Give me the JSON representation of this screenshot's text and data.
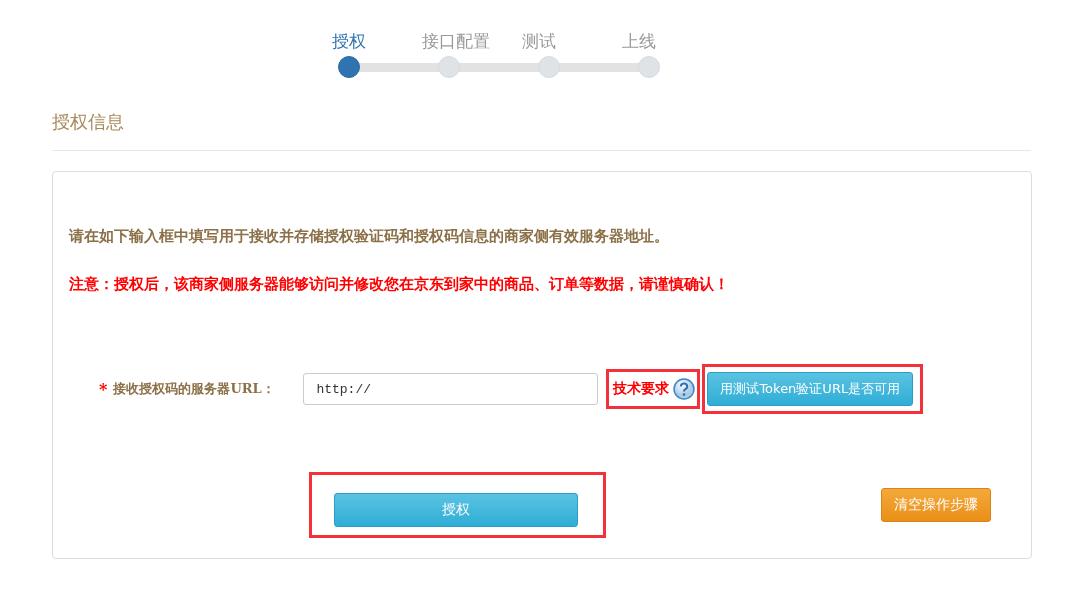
{
  "steps": [
    {
      "label": "授权",
      "selected": true
    },
    {
      "label": "接口配置",
      "selected": false
    },
    {
      "label": "测试",
      "selected": false
    },
    {
      "label": "上线",
      "selected": false
    }
  ],
  "section_title": "授权信息",
  "intro": "请在如下输入框中填写用于接收并存储授权验证码和授权码信息的商家侧有效服务器地址。",
  "warning": "注意：授权后，该商家侧服务器能够访问并修改您在京东到家中的商品、订单等数据，请谨慎确认！",
  "form": {
    "required_mark": "*",
    "label": "接收授权码的服务器URL：",
    "value": "http://",
    "tech_link": {
      "label": "技术要求",
      "highlighted": true
    },
    "test_button": {
      "label": "用测试Token验证URL是否可用",
      "highlighted": true
    }
  },
  "authorize_button": {
    "label": "授权",
    "highlighted": true
  },
  "clear_button": {
    "label": "清空操作步骤"
  }
}
